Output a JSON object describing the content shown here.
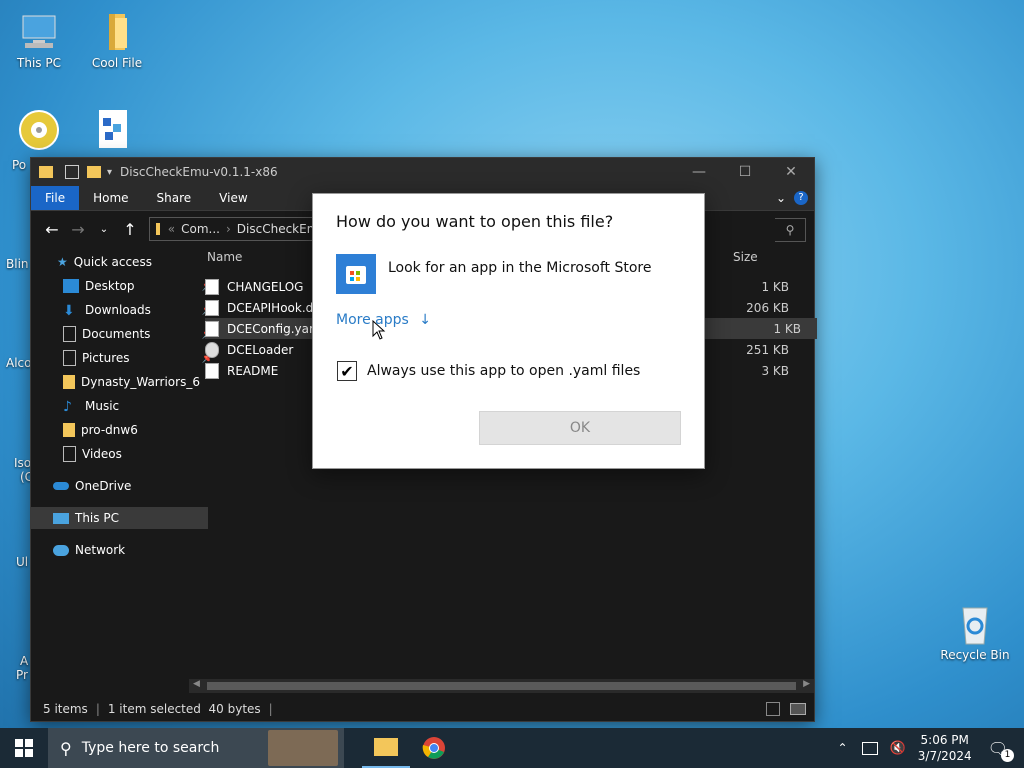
{
  "desktop": {
    "icons": [
      {
        "label": "This PC"
      },
      {
        "label": "Cool File"
      },
      {
        "label": "Recycle Bin"
      }
    ],
    "partial_labels": [
      "Po",
      "Blin",
      "Alco",
      "Iso",
      "(C",
      "Ul",
      "A",
      "Pr"
    ]
  },
  "explorer": {
    "title": "DiscCheckEmu-v0.1.1-x86",
    "ribbon_tabs": [
      "File",
      "Home",
      "Share",
      "View"
    ],
    "address": {
      "root": "Com...",
      "current": "DiscCheckEmu"
    },
    "nav": [
      {
        "label": "Quick access"
      },
      {
        "label": "Desktop",
        "pinned": true
      },
      {
        "label": "Downloads",
        "pinned": true
      },
      {
        "label": "Documents",
        "pinned": true
      },
      {
        "label": "Pictures",
        "pinned": true
      },
      {
        "label": "Dynasty_Warriors_6"
      },
      {
        "label": "Music"
      },
      {
        "label": "pro-dnw6"
      },
      {
        "label": "Videos"
      },
      {
        "label": "OneDrive"
      },
      {
        "label": "This PC"
      },
      {
        "label": "Network"
      }
    ],
    "columns": {
      "name": "Name",
      "size": "Size"
    },
    "files": [
      {
        "name": "CHANGELOG",
        "size": "1 KB"
      },
      {
        "name": "DCEAPIHook.dll",
        "size": "206 KB"
      },
      {
        "name": "DCEConfig.yam",
        "size": "1 KB",
        "selected": true
      },
      {
        "name": "DCELoader",
        "size": "251 KB"
      },
      {
        "name": "README",
        "size": "3 KB"
      }
    ],
    "status": {
      "items": "5 items",
      "selection": "1 item selected  40 bytes"
    }
  },
  "dialog": {
    "title": "How do you want to open this file?",
    "store_option": "Look for an app in the Microsoft Store",
    "more_apps": "More apps",
    "more_apps_arrow": "↓",
    "always_use": "Always use this app to open .yaml files",
    "always_use_checked": true,
    "ok": "OK"
  },
  "taskbar": {
    "search_placeholder": "Type here to search",
    "time": "5:06 PM",
    "date": "3/7/2024",
    "notification_count": "1"
  },
  "colors": {
    "accent": "#1a66c7",
    "link": "#2a7cc7",
    "taskbar": "#1b2a36"
  }
}
